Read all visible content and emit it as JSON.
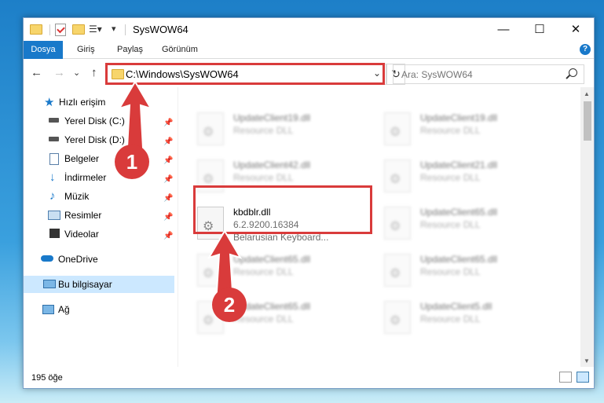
{
  "window": {
    "title": "SysWOW64",
    "min": "—",
    "max": "☐",
    "close": "✕"
  },
  "ribbon": {
    "tabs": [
      "Dosya",
      "Giriş",
      "Paylaş",
      "Görünüm"
    ],
    "help": "?"
  },
  "nav": {
    "back": "←",
    "forward": "→",
    "recent": "⌄",
    "up": "↑",
    "address": "C:\\Windows\\SysWOW64",
    "dropdown": "⌄",
    "refresh": "↻",
    "search_placeholder": "Ara: SysWOW64"
  },
  "sidebar": {
    "items": [
      {
        "label": "Hızlı erişim",
        "icon": "star-icon"
      },
      {
        "label": "Yerel Disk (C:)",
        "icon": "drive-icon",
        "pinned": true
      },
      {
        "label": "Yerel Disk (D:)",
        "icon": "drive-icon",
        "pinned": true
      },
      {
        "label": "Belgeler",
        "icon": "documents-icon",
        "pinned": true
      },
      {
        "label": "İndirmeler",
        "icon": "downloads-icon",
        "pinned": true
      },
      {
        "label": "Müzik",
        "icon": "music-icon",
        "pinned": true
      },
      {
        "label": "Resimler",
        "icon": "pictures-icon",
        "pinned": true
      },
      {
        "label": "Videolar",
        "icon": "videos-icon",
        "pinned": true
      },
      {
        "label": "OneDrive",
        "icon": "cloud-icon"
      },
      {
        "label": "Bu bilgisayar",
        "icon": "computer-icon",
        "selected": true
      },
      {
        "label": "Ağ",
        "icon": "network-icon"
      }
    ]
  },
  "files": [
    {
      "name": "UpdateClient19.dll",
      "type": "Resource DLL"
    },
    {
      "name": "UpdateClient19.dll",
      "type": "Resource DLL"
    },
    {
      "name": "UpdateClient42.dll",
      "type": "Resource DLL"
    },
    {
      "name": "UpdateClient21.dll",
      "type": "Resource DLL"
    },
    {
      "name": "kbdblr.dll",
      "version": "6.2.9200.16384",
      "description": "Belarusian Keyboard..."
    },
    {
      "name": "UpdateClient65.dll",
      "type": "Resource DLL"
    },
    {
      "name": "UpdateClient65.dll",
      "type": "Resource DLL"
    },
    {
      "name": "UpdateClient65.dll",
      "type": "Resource DLL"
    },
    {
      "name": "UpdateClient65.dll",
      "type": "Resource DLL"
    },
    {
      "name": "UpdateClient5.dll",
      "type": "Resource DLL"
    }
  ],
  "status": {
    "count": "195 öğe"
  },
  "annotations": {
    "step1": "1",
    "step2": "2",
    "highlight_color": "#d93b3b"
  }
}
